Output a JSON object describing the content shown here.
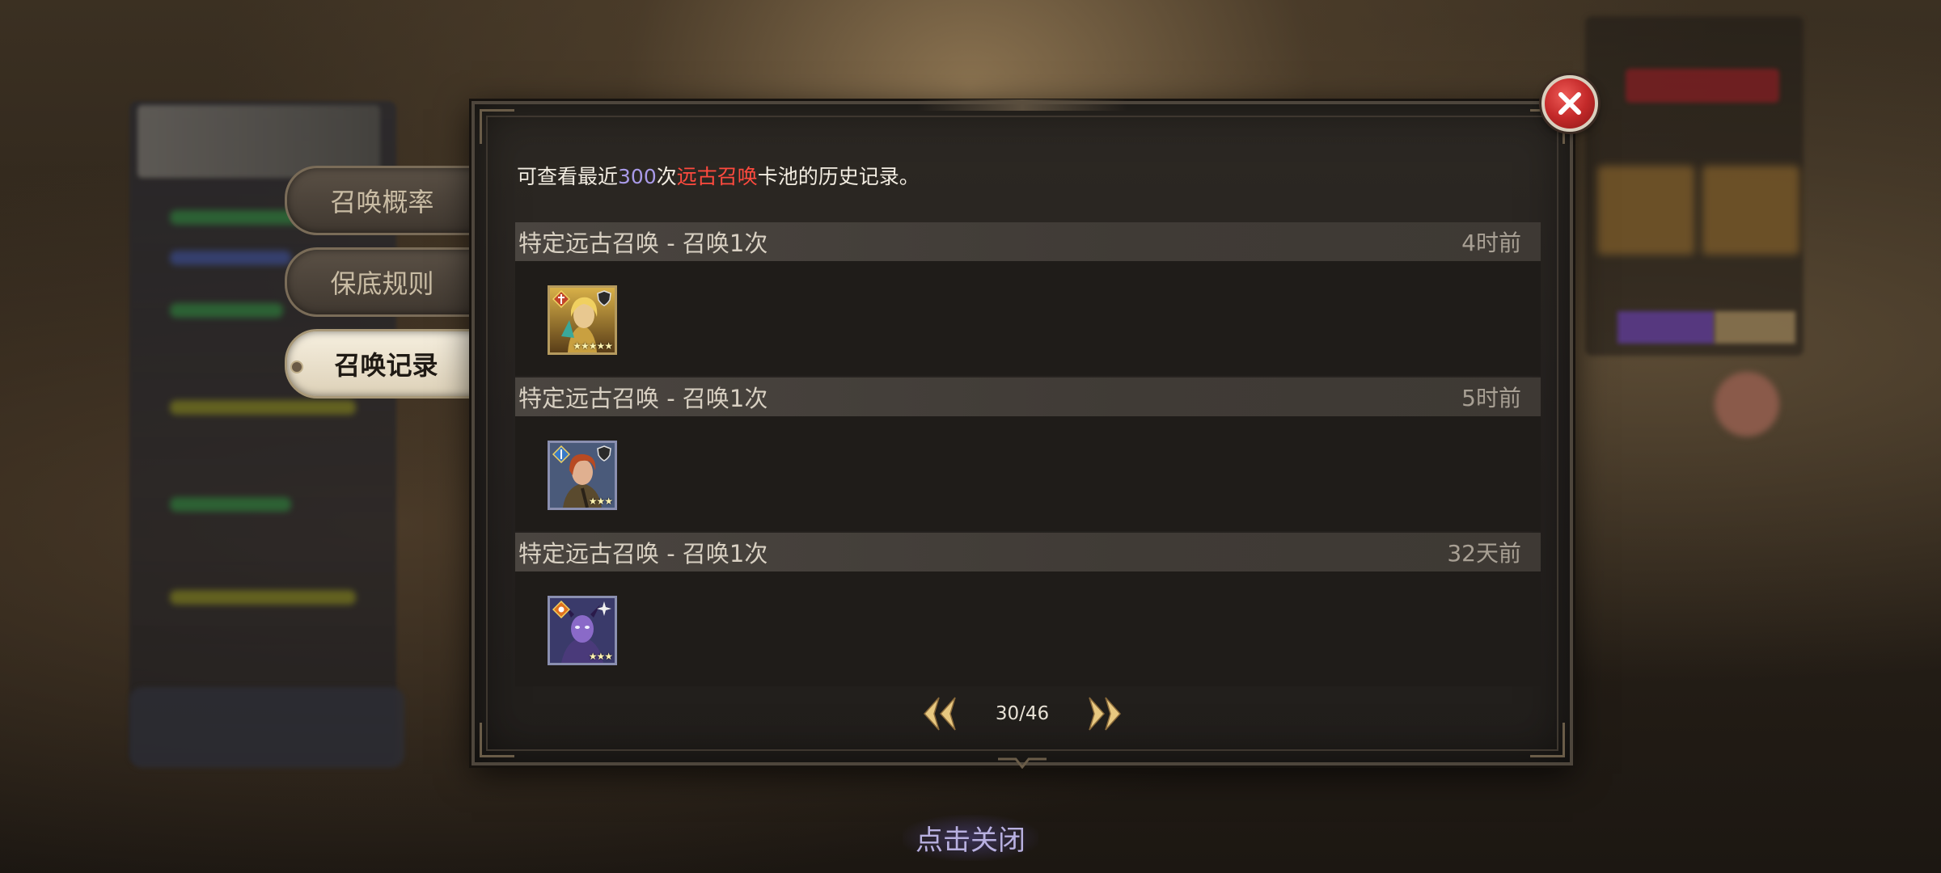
{
  "tabs": [
    {
      "label": "召唤概率",
      "active": false
    },
    {
      "label": "保底规则",
      "active": false
    },
    {
      "label": "召唤记录",
      "active": true
    }
  ],
  "info": {
    "prefix": "可查看最近",
    "count": "300",
    "middle": "次",
    "pool_name": "远古召唤",
    "suffix": "卡池的历史记录。"
  },
  "records": [
    {
      "title": "特定远古召唤 - 召唤1次",
      "time": "4时前",
      "hero": {
        "icon": "golden-knight-portrait-icon",
        "stars": 5,
        "rarity_color": "#b59a5e"
      }
    },
    {
      "title": "特定远古召唤 - 召唤1次",
      "time": "5时前",
      "hero": {
        "icon": "red-haired-archer-portrait-icon",
        "stars": 3,
        "rarity_color": "#8a8fb0"
      }
    },
    {
      "title": "特定远古召唤 - 召唤1次",
      "time": "32天前",
      "hero": {
        "icon": "purple-demon-mage-portrait-icon",
        "stars": 3,
        "rarity_color": "#8a8fb0"
      }
    }
  ],
  "pagination": {
    "text": "30/46"
  },
  "footer": {
    "tap_to_close": "点击关闭"
  },
  "colors": {
    "count_highlight": "#a99ae8",
    "pool_highlight": "#ff4a3e",
    "close_button": "#c42a2a"
  }
}
